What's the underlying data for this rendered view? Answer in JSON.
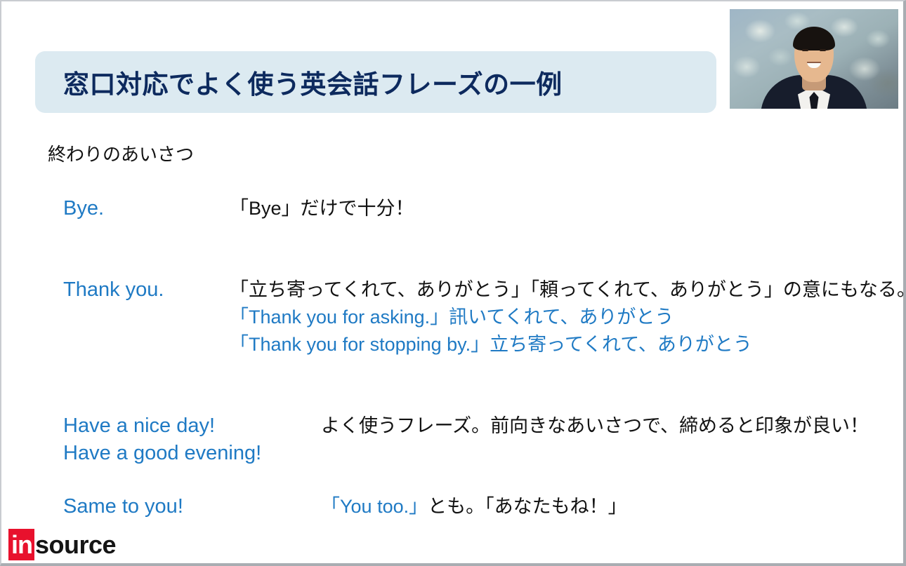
{
  "slide": {
    "title": "窓口対応でよく使う英会話フレーズの一例",
    "section_heading": "終わりのあいさつ",
    "accent_blue": "#1f7ac4",
    "title_bar_bg": "#dceaf1",
    "title_text_color": "#0d2a5e",
    "logo": {
      "mark": "in",
      "word": "source",
      "mark_bg": "#e8112d"
    },
    "video_overlay": {
      "name": "presenter-video-thumbnail",
      "description": "男性講師（スーツ姿）・葉柄の背景"
    },
    "rows": [
      {
        "phrase": "Bye.",
        "desc_column": "a",
        "lines": [
          [
            {
              "text": "「Bye」だけで十分！",
              "color": "black"
            }
          ]
        ]
      },
      {
        "phrase": "Thank you.",
        "desc_column": "a",
        "lines": [
          [
            {
              "text": "「立ち寄ってくれて、ありがとう」「頼ってくれて、ありがとう」の意にもなる。",
              "color": "black"
            }
          ],
          [
            {
              "text": "「Thank you for asking.」訊いてくれて、ありがとう",
              "color": "blue"
            }
          ],
          [
            {
              "text": "「Thank you for stopping by.」立ち寄ってくれて、ありがとう",
              "color": "blue"
            }
          ]
        ]
      },
      {
        "phrase": "Have a nice day!",
        "phrase2": "Have a good evening!",
        "desc_column": "b",
        "lines": [
          [
            {
              "text": "よく使うフレーズ。前向きなあいさつで、締めると印象が良い！",
              "color": "black"
            }
          ]
        ]
      },
      {
        "phrase": "Same to you!",
        "desc_column": "b",
        "lines": [
          [
            {
              "text": "「You too.」",
              "color": "blue"
            },
            {
              "text": "とも。「あなたもね！」",
              "color": "black"
            }
          ]
        ]
      }
    ]
  }
}
